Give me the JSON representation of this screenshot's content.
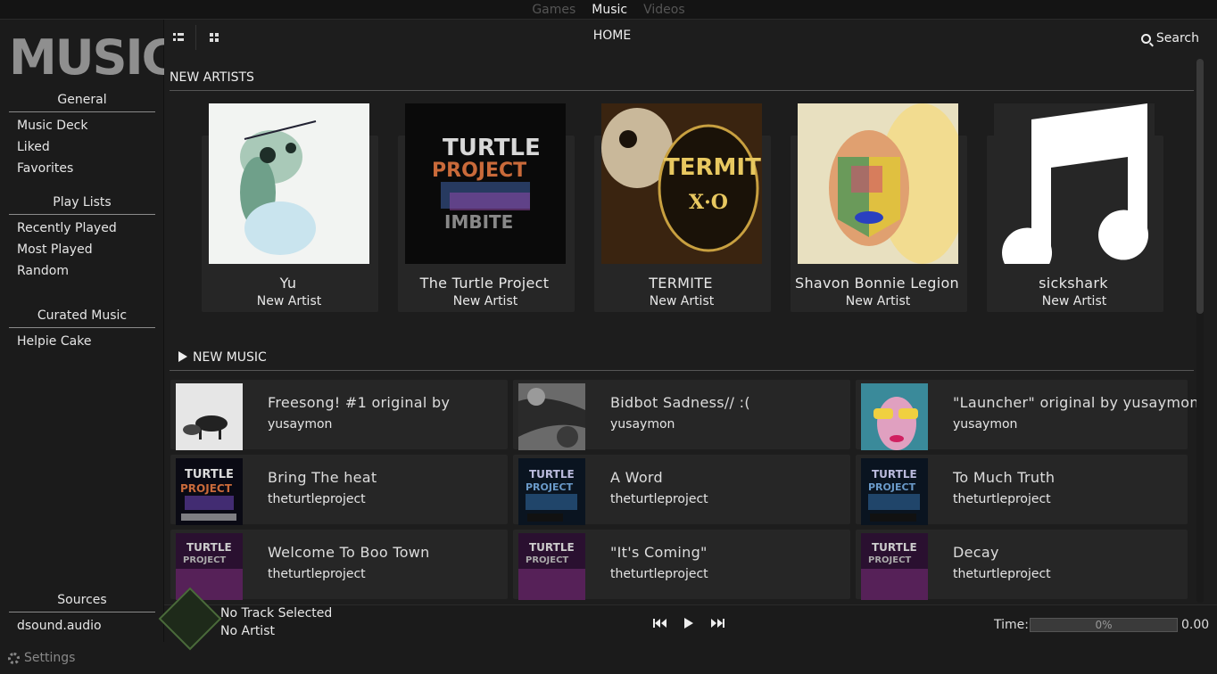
{
  "top_tabs": [
    {
      "label": "Games",
      "active": false
    },
    {
      "label": "Music",
      "active": true
    },
    {
      "label": "Videos",
      "active": false
    }
  ],
  "sidebar": {
    "logo_text": "MUSIC",
    "sections": [
      {
        "title": "General",
        "items": [
          "Music Deck",
          "Liked",
          "Favorites"
        ]
      },
      {
        "title": "Play Lists",
        "items": [
          "Recently Played",
          "Most Played",
          "Random"
        ]
      },
      {
        "title": "Curated Music",
        "items": [
          "Helpie Cake"
        ]
      },
      {
        "title": "Sources",
        "items": [
          "dsound.audio"
        ]
      }
    ],
    "settings_label": "Settings"
  },
  "header": {
    "title": "HOME",
    "search_label": "Search"
  },
  "new_artists": {
    "title": "NEW ARTISTS",
    "artists": [
      {
        "name": "Yu",
        "sub": "New Artist"
      },
      {
        "name": "The Turtle Project",
        "sub": "New Artist"
      },
      {
        "name": "TERMITE",
        "sub": "New Artist"
      },
      {
        "name": "Shavon Bonnie Legion",
        "sub": "New Artist"
      },
      {
        "name": "sickshark",
        "sub": "New Artist"
      }
    ]
  },
  "new_music": {
    "title": "NEW MUSIC",
    "tracks": [
      {
        "title": "Freesong! #1 original by",
        "artist": "yusaymon"
      },
      {
        "title": "Bidbot Sadness//      :(",
        "artist": "yusaymon"
      },
      {
        "title": "\"Launcher\" original by yusaymon",
        "artist": "yusaymon"
      },
      {
        "title": "Bring The heat",
        "artist": "theturtleproject"
      },
      {
        "title": "A Word",
        "artist": "theturtleproject"
      },
      {
        "title": "To Much Truth",
        "artist": "theturtleproject"
      },
      {
        "title": "Welcome To Boo Town",
        "artist": "theturtleproject"
      },
      {
        "title": "\"It's Coming\"",
        "artist": "theturtleproject"
      },
      {
        "title": "Decay",
        "artist": "theturtleproject"
      }
    ]
  },
  "player": {
    "track": "No Track Selected",
    "artist": "No Artist",
    "time_label": "Time:",
    "progress_text": "0%",
    "progress_value": 0,
    "time_value": "0.00"
  },
  "colors": {
    "accent": "#5a7a3a",
    "background": "#1b1b1b",
    "card": "#262626"
  }
}
